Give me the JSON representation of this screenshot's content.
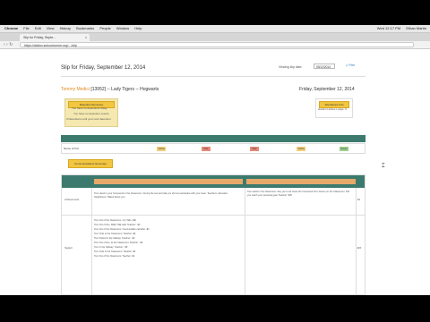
{
  "menubar": {
    "items": [
      "Chrome",
      "File",
      "Edit",
      "View",
      "History",
      "Bookmarks",
      "People",
      "Window",
      "Help"
    ],
    "clock": "Wed 12:17 PM",
    "user": "Ethan Martin"
  },
  "browser": {
    "tab_title": "Slip for Friday, Septe...",
    "url": "https://dalton.schoolrunner.org/.../slip"
  },
  "page": {
    "title": "Slip for Friday, September 12, 2014",
    "view_as_label": "Viewing slip date:",
    "date_value": "09/12/2014",
    "print_label": "Print",
    "student_name": "Tommy Medici",
    "student_rest": " [13952] -- Lady Tigers -- Hogwarts",
    "date_right": "Friday, September 12, 2014",
    "yellow_header": "Detention Summary",
    "yellow_lines": [
      "You have no detentions today.",
      "You have no detention events.",
      "0 Detentions until your next detention."
    ],
    "right_header": "Attendance Info",
    "right_line": "Hawk's Hollow Lodge: 0",
    "table1_row_label": "Name of Kid",
    "chips": [
      "Yellow",
      "Red",
      "Red",
      "Yellow",
      "Green"
    ],
    "comm_button": "Communications Summary"
  },
  "table2": {
    "row1_label": "Achievements",
    "row1_value": "$3",
    "row2_label": "Neglect",
    "row2_value": "-$20",
    "row1_text": "Tom Hand in your homework in the Classroom. During the test and talk you did not participate with your team. Teachers: Attended. Neighbours: Talked about you.",
    "row1_right": "Tom Hand in the Classroom. Say yes to all. Have the homework from lesson on the Classroom. Did you reach your personal goal. Teacher: $25",
    "row2_lines": [
      "Tom Out of the Classroom. Cry Talk (-$2)",
      "Tom Out of line. Walk THE Hall. Teacher: -$3",
      "Tom Out of the Classroom: Irrecoverable call after -$1",
      "Tom Chat in the Classroom: Teacher -$2",
      "Tom Kicked in the hallway. Teacher: -$2",
      "Tom Out of line, at the Classroom: Teacher: -$2",
      "Tom In the hallway: Teacher: -$5",
      "Tom Chat in the Classroom: Teacher -$1",
      "Tom Out of the Classroom: Teacher -$2"
    ]
  }
}
